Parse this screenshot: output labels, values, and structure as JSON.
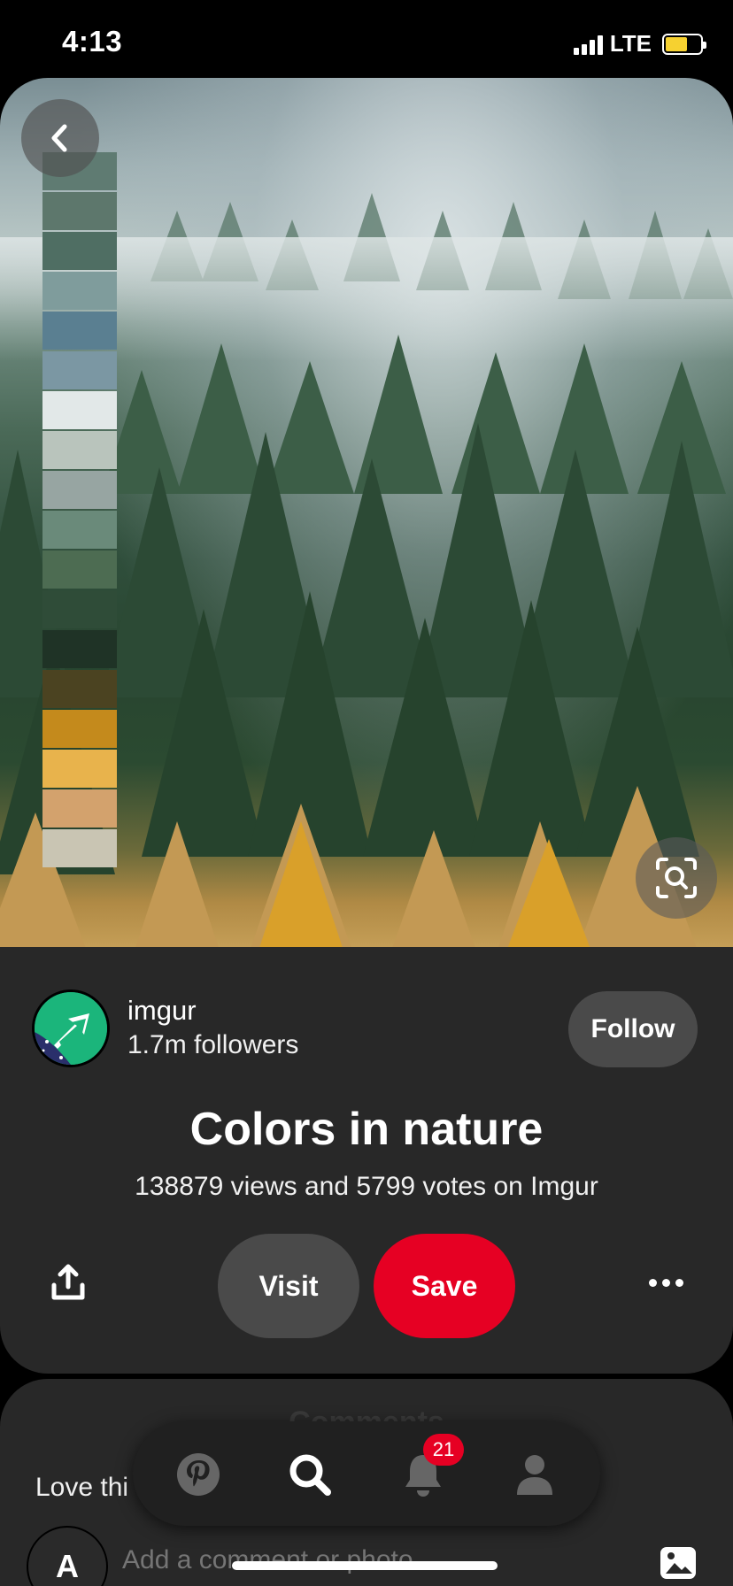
{
  "status_bar": {
    "time": "4:13",
    "network": "LTE"
  },
  "pin": {
    "palette": [
      "#5f7b72",
      "#5d776c",
      "#4f6e63",
      "#7f9c9c",
      "#5a7f91",
      "#7b97a3",
      "#e2e8e8",
      "#b9c4bc",
      "#97a5a2",
      "#6a8a7a",
      "#4d6c52",
      "#2f4c38",
      "#1f3326",
      "#4b4321",
      "#c48a1c",
      "#e8b34c",
      "#d3a26d",
      "#c9c5b3"
    ]
  },
  "creator": {
    "name": "imgur",
    "followers": "1.7m followers",
    "follow_label": "Follow"
  },
  "details": {
    "title": "Colors in nature",
    "description": "138879 views and 5799 votes on Imgur"
  },
  "actions": {
    "visit_label": "Visit",
    "save_label": "Save"
  },
  "comments": {
    "heading": "Comments",
    "teaser": "Love thi",
    "avatar_letter": "A",
    "placeholder": "Add a comment or photo"
  },
  "nav": {
    "notifications_count": "21"
  },
  "colors": {
    "accent": "#e60023",
    "card_bg": "#282828"
  }
}
